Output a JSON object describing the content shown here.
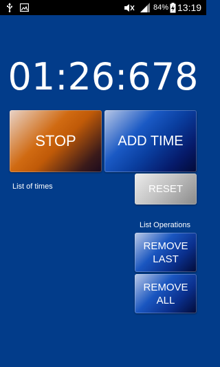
{
  "status_bar": {
    "time": "13:19",
    "battery_percent": "84%",
    "icons": [
      "usb-icon",
      "image-icon",
      "mute-icon",
      "signal-icon",
      "battery-charging-icon"
    ]
  },
  "timer": {
    "display": "01:26:678"
  },
  "buttons": {
    "stop": "STOP",
    "add_time": "ADD TIME",
    "reset": "RESET",
    "remove_last": "REMOVE\nLAST",
    "remove_all": "REMOVE\nALL"
  },
  "labels": {
    "list_of_times": "List of times",
    "list_operations": "List Operations"
  },
  "colors": {
    "background": "#023c8a",
    "stop_accent": "#d06a12",
    "add_accent": "#1a59c4",
    "reset_accent": "#c4c4c4"
  }
}
